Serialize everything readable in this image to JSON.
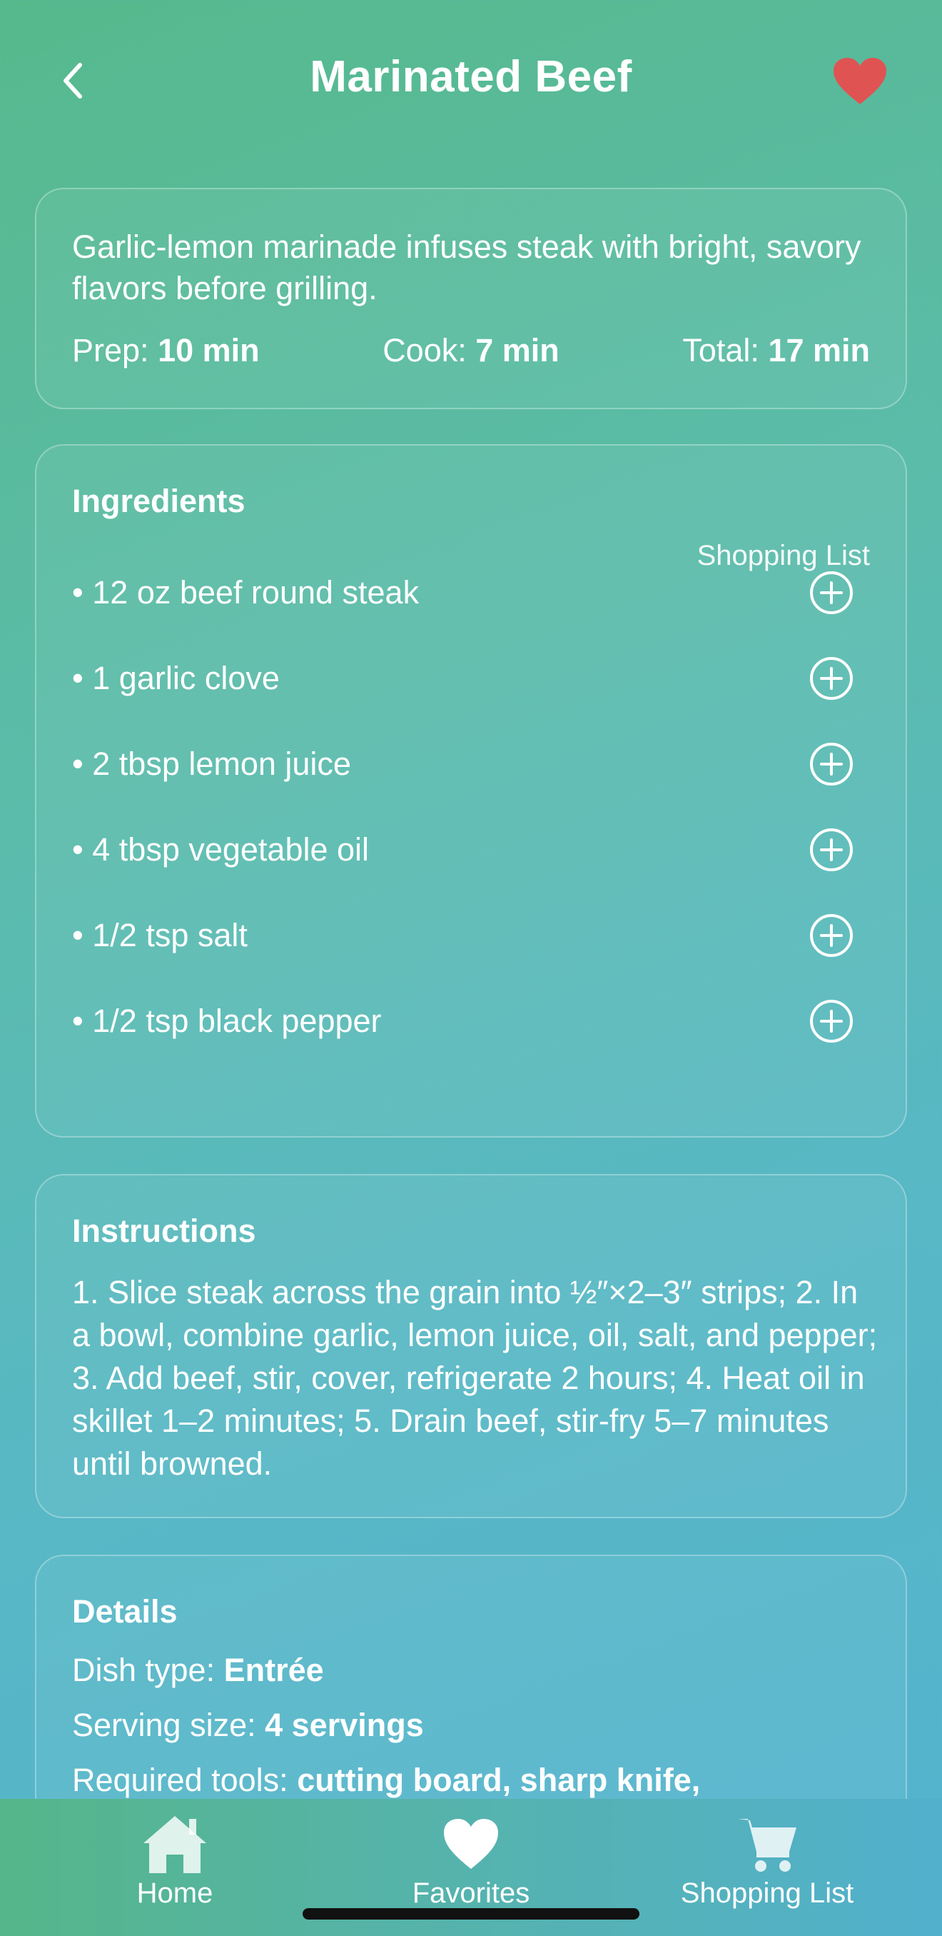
{
  "header": {
    "title": "Marinated Beef",
    "back_icon": "chevron-left-icon",
    "favorite_icon": "heart-icon",
    "favorite_color": "#e05353"
  },
  "summary": {
    "description": "Garlic-lemon marinade infuses steak with bright, savory flavors before grilling.",
    "prep_label": "Prep:",
    "prep_value": "10 min",
    "cook_label": "Cook:",
    "cook_value": "7 min",
    "total_label": "Total:",
    "total_value": "17 min"
  },
  "ingredients": {
    "heading": "Ingredients",
    "shopping_list_label": "Shopping List",
    "items": [
      "• 12 oz beef round steak",
      "• 1 garlic clove",
      "• 2 tbsp lemon juice",
      "• 4 tbsp vegetable oil",
      "• 1/2 tsp salt",
      "• 1/2 tsp black pepper"
    ]
  },
  "instructions": {
    "heading": "Instructions",
    "text": "1. Slice steak across the grain into ½″×2–3″ strips; 2. In a bowl, combine garlic, lemon juice, oil, salt, and pepper; 3. Add beef, stir, cover, refrigerate 2 hours; 4. Heat oil in skillet 1–2 minutes; 5. Drain beef, stir-fry 5–7 minutes until browned."
  },
  "details": {
    "heading": "Details",
    "dish_type_label": "Dish type:",
    "dish_type_value": "Entrée",
    "serving_size_label": "Serving size:",
    "serving_size_value": "4 servings",
    "tools_label": "Required tools:",
    "tools_value": "cutting board, sharp knife,"
  },
  "tabbar": {
    "tabs": [
      {
        "label": "Home",
        "icon": "home-icon"
      },
      {
        "label": "Favorites",
        "icon": "heart-icon"
      },
      {
        "label": "Shopping List",
        "icon": "cart-icon"
      }
    ]
  }
}
